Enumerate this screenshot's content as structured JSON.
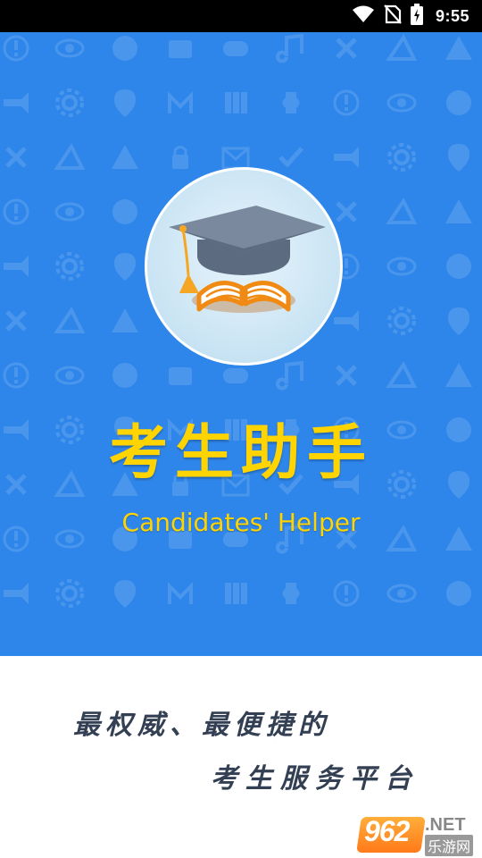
{
  "status_bar": {
    "time": "9:55",
    "icons": [
      "wifi-icon",
      "no-sim-icon",
      "battery-charging-icon"
    ]
  },
  "splash": {
    "background_color": "#2f86ea",
    "title": "考生助手",
    "subtitle": "Candidates' Helper",
    "title_color": "#ffd400",
    "logo_icons": [
      "graduation-cap-icon",
      "open-book-icon"
    ]
  },
  "slogan": {
    "line1": "最权威、最便捷的",
    "line2": "考生服务平台"
  },
  "watermark": {
    "number": "962",
    "domain": ".NET",
    "site_name": "乐游网"
  }
}
